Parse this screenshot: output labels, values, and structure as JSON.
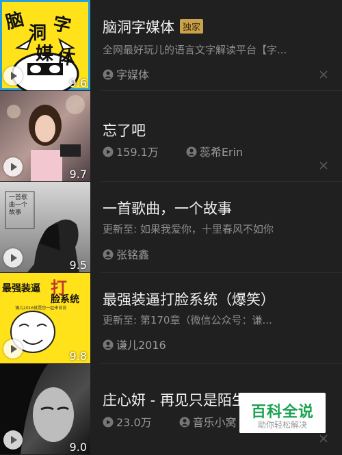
{
  "items": [
    {
      "title": "脑洞字媒体",
      "badge": "独家",
      "subtitle": "全网最好玩儿的语言文字解读平台【字...",
      "author": "字媒体",
      "score": "9.6",
      "cover_text": [
        "脑",
        "洞",
        "字",
        "媒",
        "体"
      ]
    },
    {
      "title": "忘了吧",
      "plays": "159.1万",
      "author": "蕊希Erin",
      "score": "9.7"
    },
    {
      "title": "一首歌曲，一个故事",
      "subtitle": "更新至: 如果我爱你，十里春风不如你",
      "author": "张铭鑫",
      "score": "9.5",
      "cover_text": "一首歌曲一个故事"
    },
    {
      "title": "最强装逼打脸系统（爆笑）",
      "subtitle": "更新至: 第170章（微信公众号：谦...",
      "author": "谦儿2016",
      "score": "9.8",
      "cover_text": [
        "最强装逼",
        "打",
        "脸系统",
        "谦儿2016就是您一起来说说"
      ]
    },
    {
      "title": "庄心妍 - 再见只是陌生人",
      "plays": "23.0万",
      "author": "音乐小窝",
      "score": "9.0"
    }
  ],
  "watermark": {
    "title": "百科全说",
    "subtitle": "助你轻松解决"
  },
  "colors": {
    "background": "#202020",
    "badge": "#c9a24b",
    "watermark_green": "#1aa351",
    "cover_yellow": "#ffe21a"
  }
}
